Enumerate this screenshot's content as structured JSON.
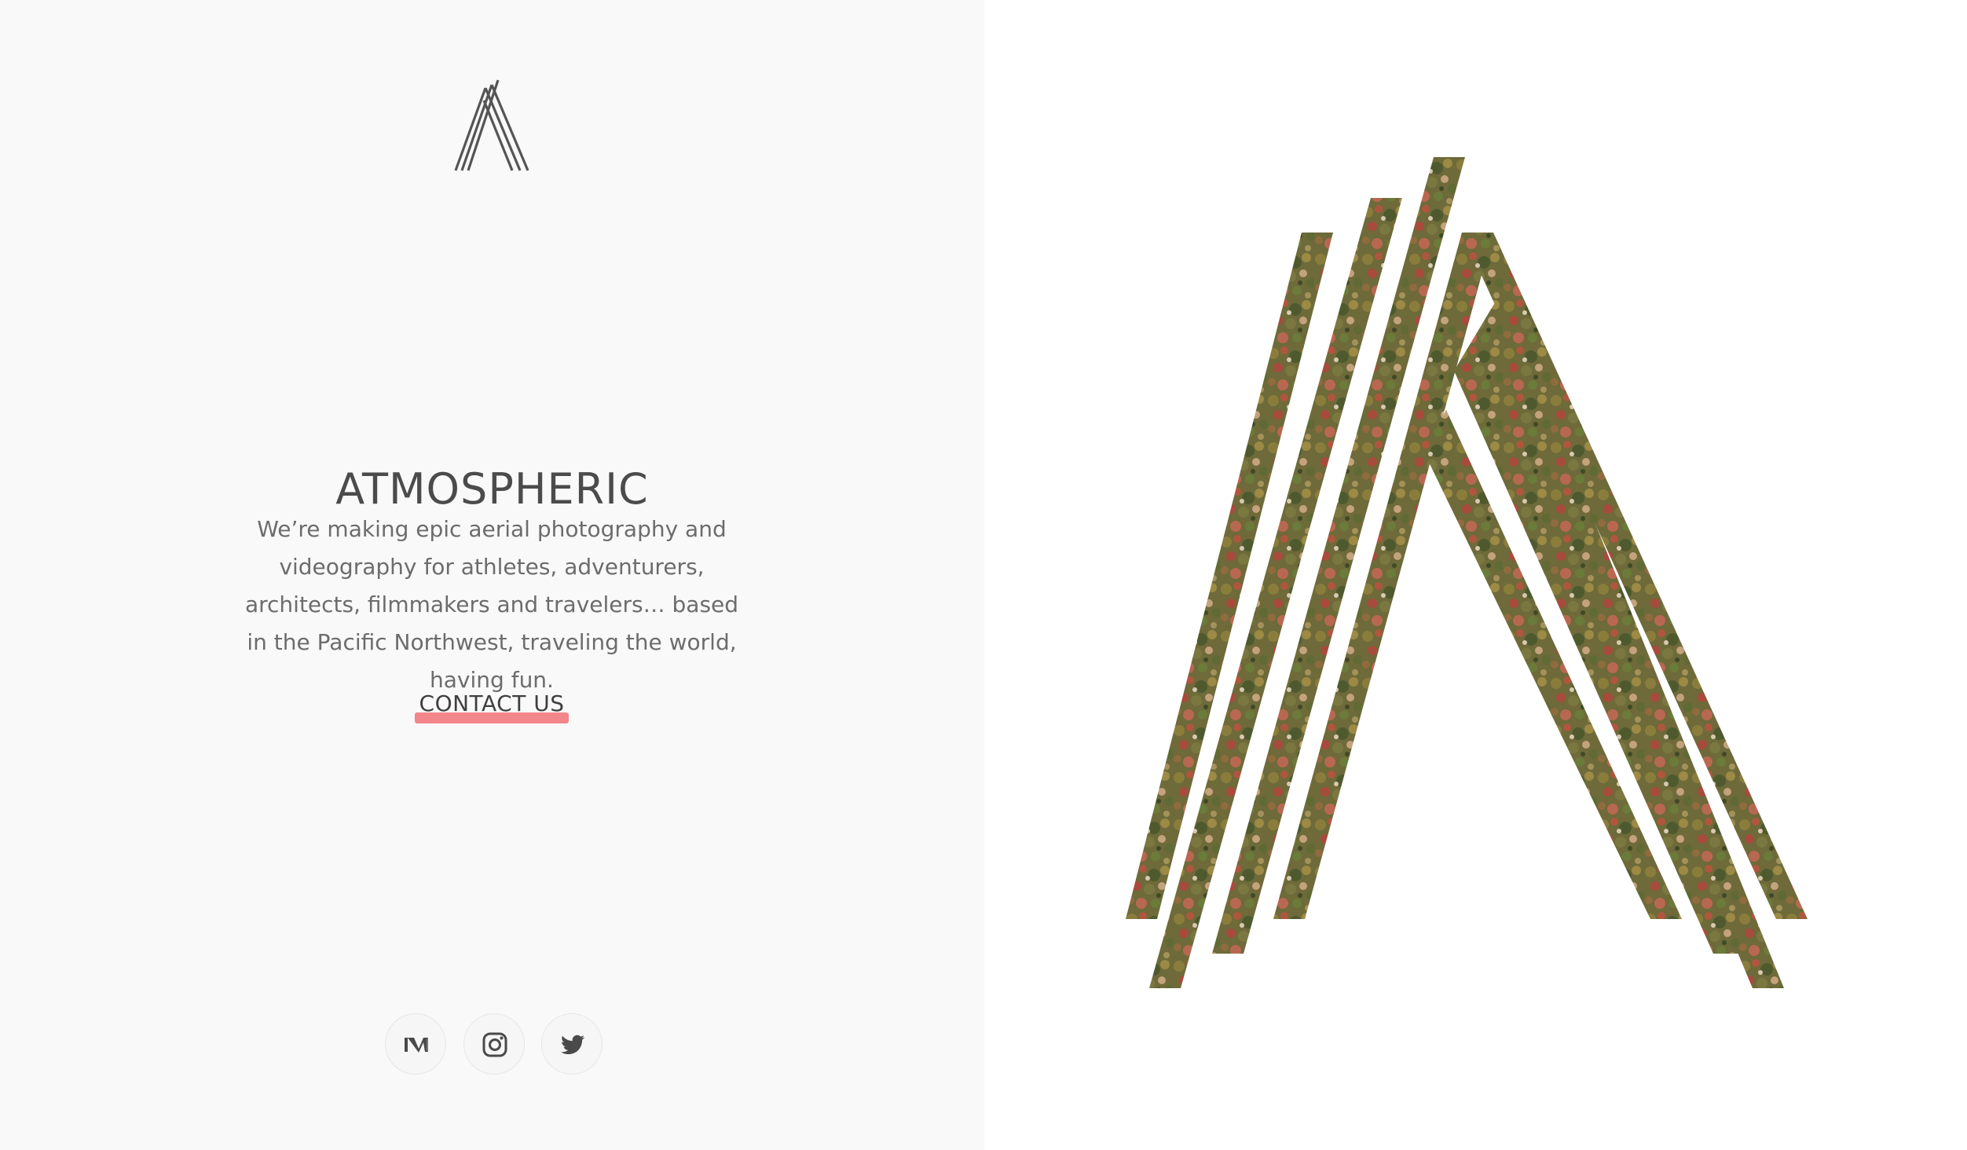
{
  "brand": {
    "logo_icon": "atmospheric-a-logo",
    "title": "ATMOSPHERIC",
    "description": "We’re making epic aerial photography and videography for athletes, adventurers, architects, filmmakers and travelers… based in the Pacific Northwest, traveling the world, having fun."
  },
  "cta": {
    "label": "CONTACT US",
    "accent_color": "#f2868b"
  },
  "social": [
    {
      "name": "Medium",
      "icon": "medium-icon"
    },
    {
      "name": "Instagram",
      "icon": "instagram-icon"
    },
    {
      "name": "Twitter",
      "icon": "twitter-icon"
    }
  ],
  "hero": {
    "icon": "aerial-foliage-a-mark"
  },
  "colors": {
    "left_panel_bg": "#f9f9f9",
    "right_panel_bg": "#ffffff",
    "text_dark": "#4b4b4b",
    "text_body": "#6c6c6c"
  }
}
